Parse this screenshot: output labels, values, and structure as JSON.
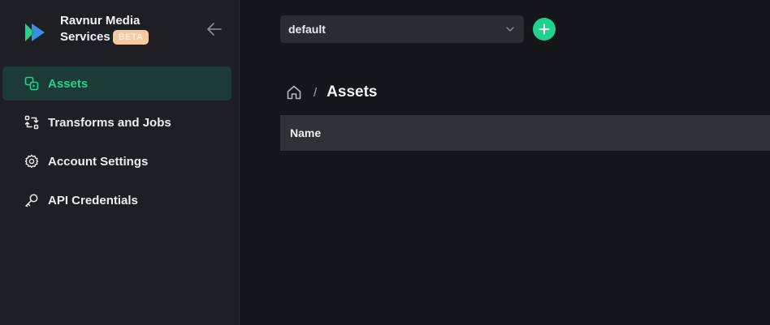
{
  "brand": {
    "name_line1": "Ravnur Media",
    "name_line2": "Services",
    "badge": "BETA",
    "colors": {
      "logo_green": "#1fd38f",
      "logo_blue": "#3a8ee6",
      "badge_bg": "#f7c9a1"
    }
  },
  "sidebar": {
    "collapse_icon": "arrow-left-icon",
    "items": [
      {
        "label": "Assets",
        "icon": "assets-icon",
        "active": true
      },
      {
        "label": "Transforms and Jobs",
        "icon": "transforms-icon",
        "active": false
      },
      {
        "label": "Account Settings",
        "icon": "gear-icon",
        "active": false
      },
      {
        "label": "API Credentials",
        "icon": "key-icon",
        "active": false
      }
    ]
  },
  "header": {
    "environment_select": {
      "value": "default",
      "icon": "chevron-down-icon"
    },
    "add_button_icon": "plus-icon"
  },
  "breadcrumb": {
    "home_icon": "home-icon",
    "separator": "/",
    "current": "Assets"
  },
  "table": {
    "columns": [
      "Name"
    ]
  },
  "colors": {
    "accent": "#1fd38f",
    "active_bg": "#1b3b34",
    "sidebar_bg": "#1e1f23",
    "main_bg": "#15161a",
    "header_bg": "#303136"
  }
}
